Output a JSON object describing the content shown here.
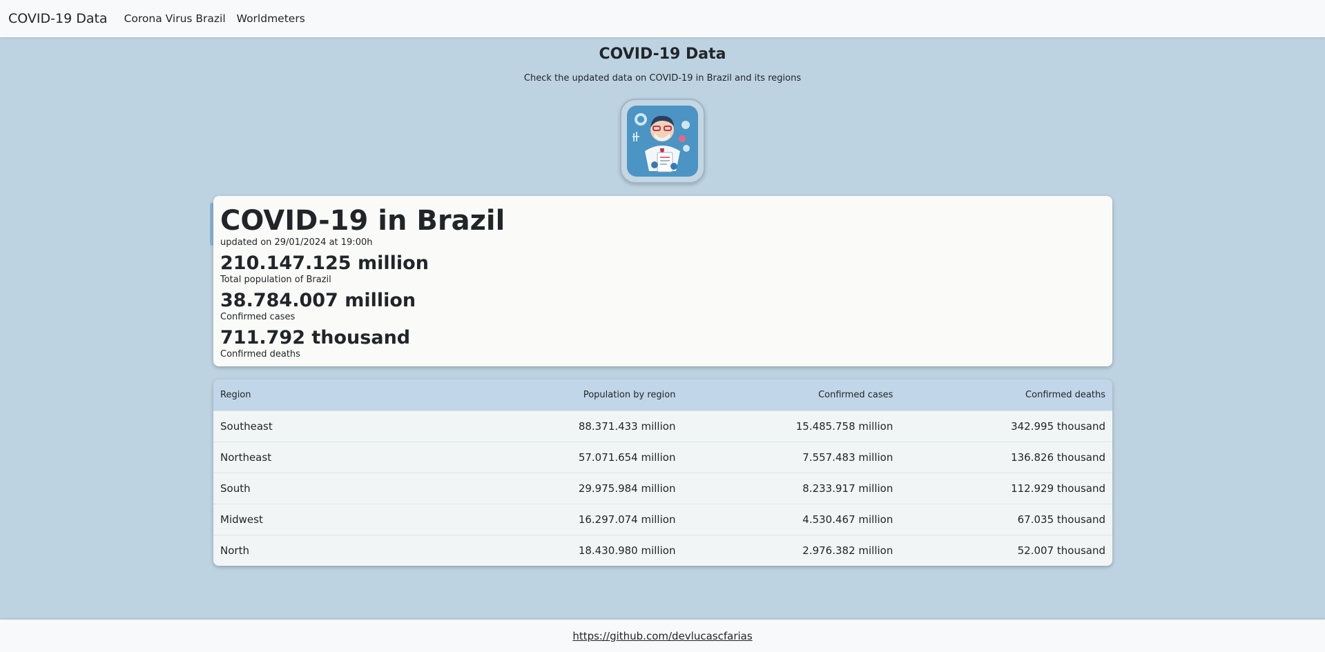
{
  "navbar": {
    "brand": "COVID-19 Data",
    "links": [
      "Corona Virus Brazil",
      "Worldmeters"
    ]
  },
  "header": {
    "title": "COVID-19 Data",
    "subtitle": "Check the updated data on COVID-19 in Brazil and its regions"
  },
  "summary": {
    "title": "COVID-19 in Brazil",
    "updated": "updated on 29/01/2024 at 19:00h",
    "stats": [
      {
        "value": "210.147.125 million",
        "label": "Total population of Brazil"
      },
      {
        "value": "38.784.007 million",
        "label": "Confirmed cases"
      },
      {
        "value": "711.792 thousand",
        "label": "Confirmed deaths"
      }
    ]
  },
  "table": {
    "headers": [
      "Region",
      "Population by region",
      "Confirmed cases",
      "Confirmed deaths"
    ],
    "rows": [
      [
        "Southeast",
        "88.371.433 million",
        "15.485.758 million",
        "342.995 thousand"
      ],
      [
        "Northeast",
        "57.071.654 million",
        "7.557.483 million",
        "136.826 thousand"
      ],
      [
        "South",
        "29.975.984 million",
        "8.233.917 million",
        "112.929 thousand"
      ],
      [
        "Midwest",
        "16.297.074 million",
        "4.530.467 million",
        "67.035 thousand"
      ],
      [
        "North",
        "18.430.980 million",
        "2.976.382 million",
        "52.007 thousand"
      ]
    ]
  },
  "footer": {
    "link": "https://github.com/devlucascfarias"
  },
  "colors": {
    "background": "#bed3e1",
    "table_header": "#c1d6e8",
    "card": "#fafbf8"
  }
}
